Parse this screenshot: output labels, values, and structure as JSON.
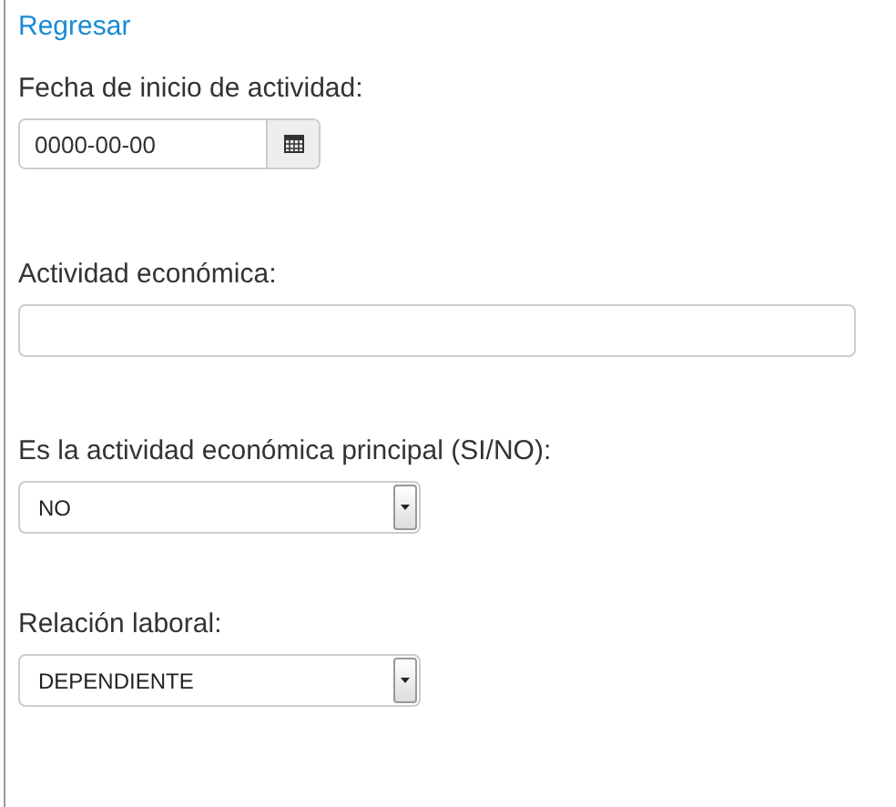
{
  "back_link": "Regresar",
  "fields": [
    {
      "kind": "date",
      "label": "Fecha de inicio de actividad:",
      "value": "0000-00-00"
    },
    {
      "kind": "text",
      "label": "Actividad económica:"
    },
    {
      "kind": "select",
      "label": "Es la actividad económica principal (SI/NO):",
      "value": "NO"
    },
    {
      "kind": "select",
      "label": "Relación laboral:",
      "value": "DEPENDIENTE"
    }
  ]
}
